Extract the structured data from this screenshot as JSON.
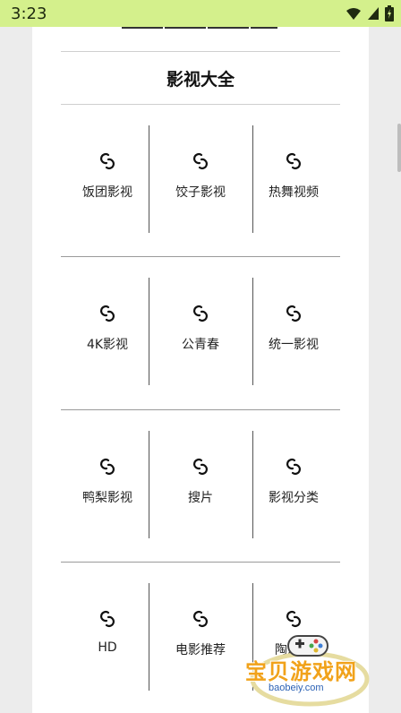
{
  "status_bar": {
    "time": "3:23"
  },
  "section": {
    "title": "影视大全"
  },
  "grid": [
    [
      "饭团影视",
      "饺子影视",
      "热舞视频"
    ],
    [
      "4K影视",
      "公青春",
      "统一影视"
    ],
    [
      "鸭梨影视",
      "搜片",
      "影视分类"
    ],
    [
      "HD",
      "电影推荐",
      "陶片网"
    ]
  ],
  "icon": "swirl-link-icon",
  "watermark": {
    "text": "宝贝游戏网",
    "url": "baobeiy.com"
  },
  "colors": {
    "status_bar": "#d4f08c",
    "background": "#ececec",
    "card": "#ffffff",
    "watermark": "#f1a21a"
  }
}
